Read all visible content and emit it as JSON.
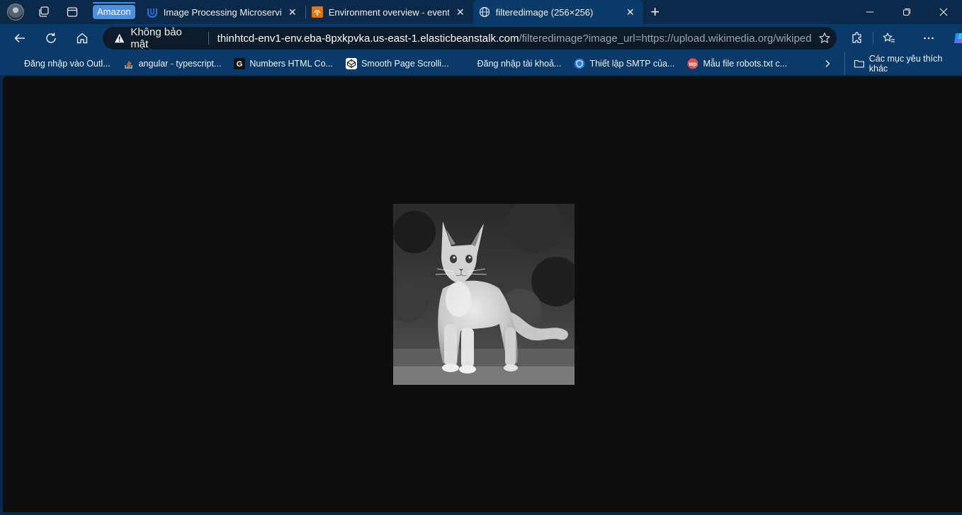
{
  "tabs": {
    "group_label": "Amazon",
    "items": [
      {
        "title": "Image Processing Microservice on",
        "favicon": "udacity-icon"
      },
      {
        "title": "Environment overview - events | E",
        "favicon": "elastic-beanstalk-icon"
      },
      {
        "title": "filteredimage (256×256)",
        "favicon": "globe-icon",
        "active": true
      }
    ],
    "new_tab_label": "+"
  },
  "address_bar": {
    "security_label": "Không bảo mật",
    "url_host": "thinhtcd-env1-env.eba-8pxkpvka.us-east-1.elasticbeanstalk.com",
    "url_rest": "/filteredimage?image_url=https://upload.wikimedia.org/wikipedia/c..."
  },
  "bookmarks": {
    "items": [
      {
        "label": "Đăng nhập vào Outl...",
        "icon": "microsoft-icon"
      },
      {
        "label": "angular - typescript...",
        "icon": "stackoverflow-icon"
      },
      {
        "label": "Numbers HTML Co...",
        "icon": "g-icon"
      },
      {
        "label": "Smooth Page Scrolli...",
        "icon": "codepen-icon"
      },
      {
        "label": "Đăng nhập tài khoả...",
        "icon": "microsoft-icon"
      },
      {
        "label": "Thiết lập SMTP của...",
        "icon": "shield-icon"
      },
      {
        "label": "Mẫu file robots.txt c...",
        "icon": "wordpress-icon"
      }
    ],
    "other_label": "Các mục yêu thích khác"
  },
  "content": {
    "image_caption": "grayscale kitten image (256×256)"
  }
}
